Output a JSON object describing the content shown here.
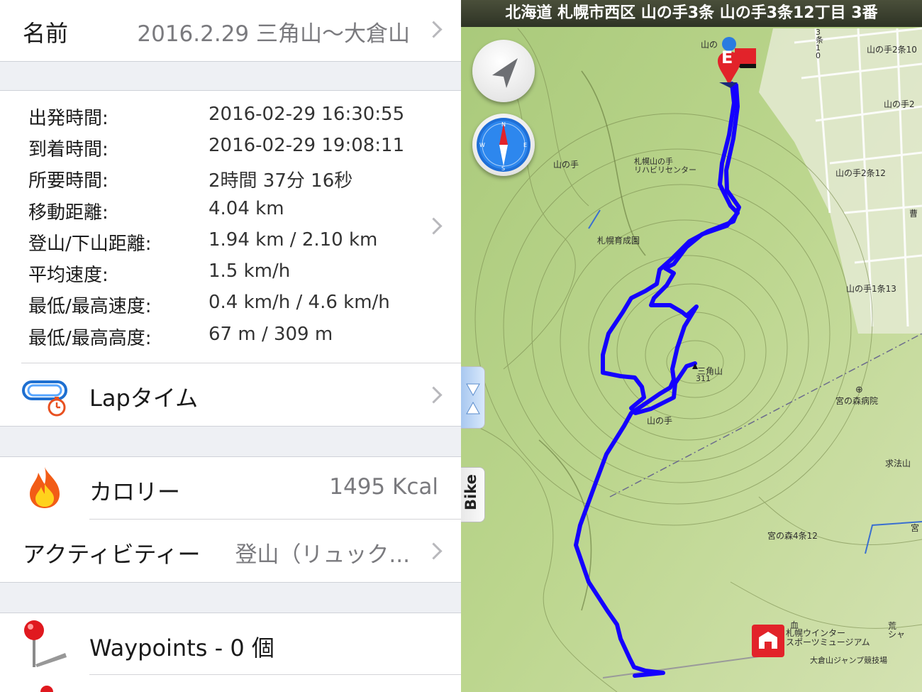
{
  "name_row": {
    "label": "名前",
    "value": "2016.2.29 三角山〜大倉山"
  },
  "stats": [
    {
      "label": "出発時間:",
      "value": "2016-02-29 16:30:55"
    },
    {
      "label": "到着時間:",
      "value": "2016-02-29 19:08:11"
    },
    {
      "label": "所要時間:",
      "value": "2時間 37分 16秒"
    },
    {
      "label": "移動距離:",
      "value": "4.04 km"
    },
    {
      "label": "登山/下山距離:",
      "value": "1.94 km / 2.10 km"
    },
    {
      "label": "平均速度:",
      "value": "1.5 km/h"
    },
    {
      "label": "最低/最高速度:",
      "value": "0.4 km/h / 4.6 km/h"
    },
    {
      "label": "最低/最高高度:",
      "value": "67 m / 309 m"
    }
  ],
  "lap": {
    "label": "Lapタイム",
    "icon": "lap-stopwatch-icon"
  },
  "calorie": {
    "label": "カロリー",
    "value": "1495 Kcal",
    "icon": "flame-icon"
  },
  "activity": {
    "label": "アクティビティー",
    "value": "登山（リュック..."
  },
  "waypoints": {
    "label": "Waypoints - 0 個",
    "icon": "pin-icon"
  },
  "map": {
    "address": "北海道 札幌市西区 山の手3条 山の手3条12丁目 3番",
    "bike_tab": "Bike",
    "end_marker": "E",
    "labels": {
      "yamanote": "山の手",
      "rehab": "札幌山の手\nリハビリセンター",
      "ikuseien": "札幌育成園",
      "sankakuyama": "三角山",
      "sankaku_height": "311",
      "yamanote_center": "山の手",
      "y2j10": "山の手2条10",
      "y2j": "山の手2",
      "y2j12": "山の手2条12",
      "y1j13": "山の手1条13",
      "miyanomori_hosp": "宮の森病院",
      "kyuhozan": "求法山",
      "miyanomori4": "宮の森4条12",
      "museum": "札幌ウインター\nスポーツミュージアム",
      "jump": "大倉山ジャンプ競技場",
      "sanjo": "3\n条\n1\n0",
      "top_small": "山の",
      "edge1": "曹",
      "edge2": "宮",
      "edge3": "荒\nシャ"
    },
    "route_color": "#1400ff",
    "accent_red": "#e2232a"
  }
}
